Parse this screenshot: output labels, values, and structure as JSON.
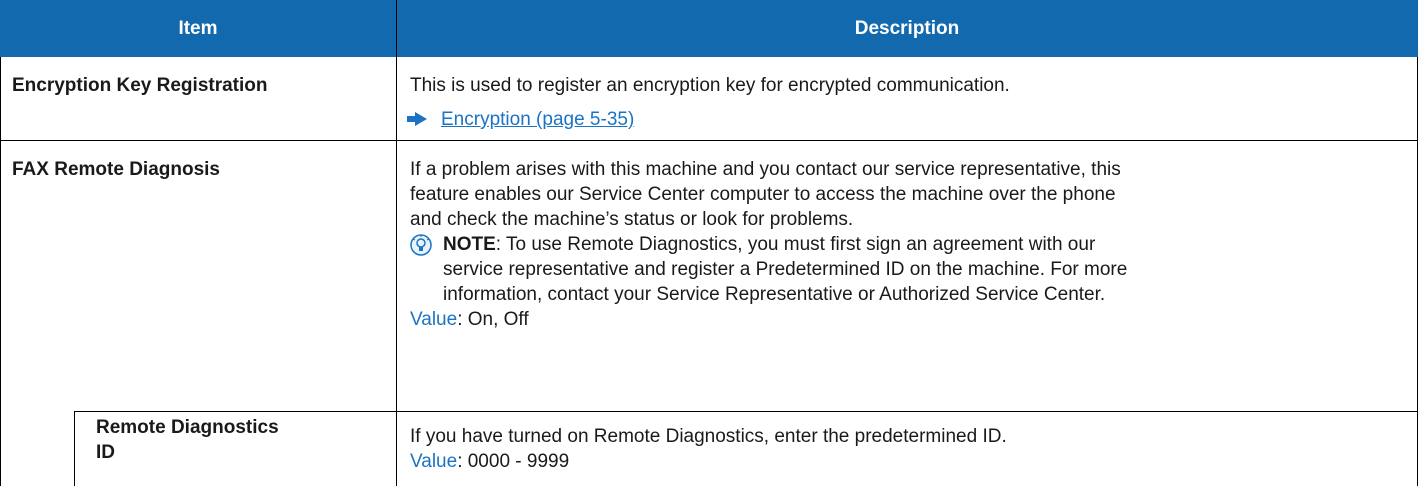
{
  "header": {
    "item": "Item",
    "description": "Description"
  },
  "rows": [
    {
      "item": "Encryption Key Registration",
      "desc_line": "This is used to register an encryption key for encrypted communication.",
      "link": "Encryption (page 5-35)"
    },
    {
      "item": "FAX Remote Diagnosis",
      "desc_lines": [
        "If a problem arises with this machine and you contact our service representative, this",
        "feature enables our Service Center computer to access the machine over the phone",
        "and check the machine’s status or look for problems."
      ],
      "note_label": "NOTE",
      "note_lines": [
        ": To use Remote Diagnostics, you must first sign an agreement with our",
        "service representative and register a Predetermined ID on the machine. For more",
        "information, contact your Service Representative or Authorized Service Center."
      ],
      "value_label": "Value",
      "value_text": ": On, Off"
    },
    {
      "item_lines": [
        "Remote Diagnostics",
        "ID"
      ],
      "desc_line": "If you have turned on Remote Diagnostics, enter the predetermined ID.",
      "value_label": "Value",
      "value_text": ": 0000 - 9999"
    }
  ],
  "colors": {
    "header_bg": "#1369ae",
    "accent": "#1c73c4"
  }
}
